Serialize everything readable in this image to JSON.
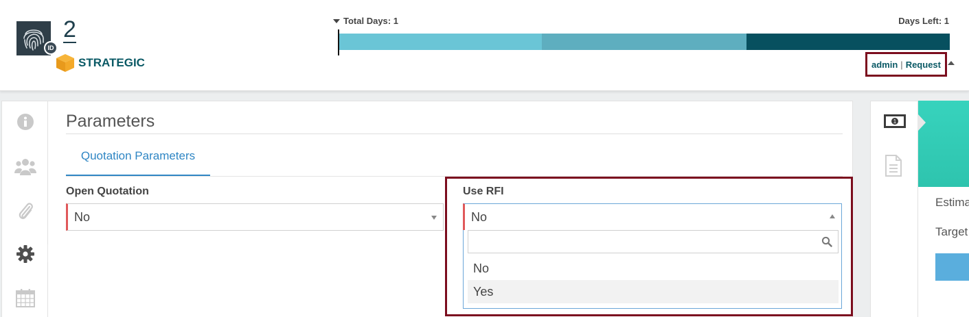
{
  "header": {
    "record_number": "2",
    "badge_text": "ID",
    "category": "STRATEGIC",
    "total_days_label": "Total Days: 1",
    "days_left_label": "Days Left: 1",
    "progress_segments": [
      {
        "color": "#6ac5d6",
        "fraction": 0.333
      },
      {
        "color": "#5eaebf",
        "fraction": 0.334
      },
      {
        "color": "#07505f",
        "fraction": 0.333
      }
    ],
    "user_link": "admin",
    "separator": "|",
    "request_link": "Request"
  },
  "sidebar": {
    "items": [
      {
        "icon": "info-icon",
        "active": false
      },
      {
        "icon": "users-icon",
        "active": false
      },
      {
        "icon": "paperclip-icon",
        "active": false
      },
      {
        "icon": "gear-icon",
        "active": true
      },
      {
        "icon": "calendar-icon",
        "active": false
      }
    ]
  },
  "main": {
    "title": "Parameters",
    "tabs": [
      {
        "label": "Quotation Parameters",
        "active": true
      }
    ],
    "fields": {
      "open_quotation": {
        "label": "Open Quotation",
        "value": "No"
      },
      "use_rfi": {
        "label": "Use RFI",
        "value": "No",
        "search_placeholder": "",
        "options": [
          "No",
          "Yes"
        ],
        "highlighted_option": "Yes"
      }
    }
  },
  "right_panel": {
    "icons": [
      "money-icon",
      "document-icon"
    ],
    "text_1": "Estima",
    "text_2": "Target",
    "accent_color": "#35cfb9"
  },
  "colors": {
    "accent_blue": "#2f86c4",
    "brand_teal": "#0a5965",
    "highlight_frame": "#7b0d1e",
    "required_marker": "#e0585a"
  }
}
